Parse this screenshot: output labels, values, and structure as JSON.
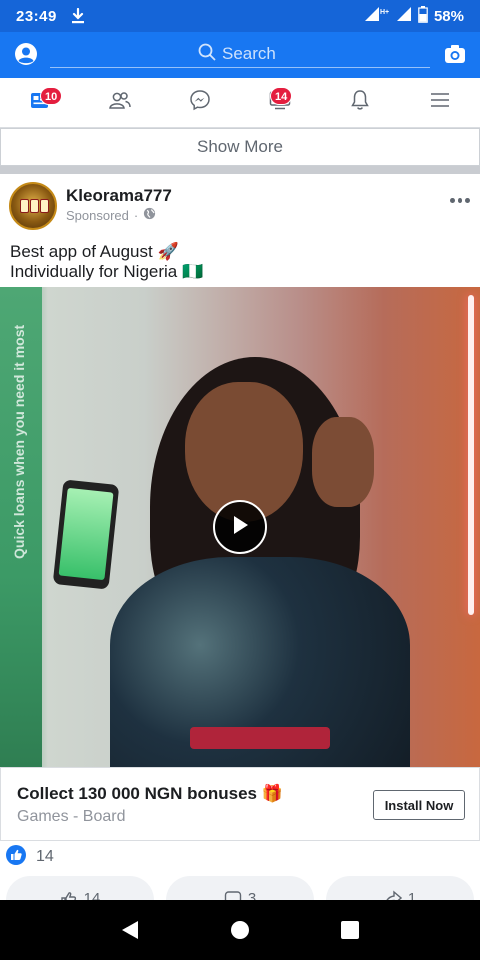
{
  "status_bar": {
    "time": "23:49",
    "battery": "58%",
    "icons": [
      "download-icon",
      "wifi-icon",
      "signal-icon",
      "battery-icon"
    ]
  },
  "header": {
    "search_placeholder": "Search",
    "icons": [
      "profile-icon",
      "search-icon",
      "camera-icon"
    ]
  },
  "nav_tabs": [
    {
      "name": "news-feed",
      "icon": "news-feed-icon",
      "badge": "10"
    },
    {
      "name": "friends",
      "icon": "friends-icon",
      "badge": ""
    },
    {
      "name": "messenger",
      "icon": "messenger-icon",
      "badge": ""
    },
    {
      "name": "watch",
      "icon": "watch-icon",
      "badge": "14"
    },
    {
      "name": "notifications",
      "icon": "bell-icon",
      "badge": ""
    },
    {
      "name": "menu",
      "icon": "menu-icon",
      "badge": ""
    }
  ],
  "feed": {
    "show_more_label": "Show More"
  },
  "post": {
    "author": "Kleorama777",
    "sponsored_label": "Sponsored",
    "meta_separator": "·",
    "text_line1": "Best app of August 🚀",
    "text_line2": "Individually for Nigeria 🇳🇬",
    "video_caption": "Quick loans when you need it most",
    "cta_title": "Collect 130 000 NGN bonuses 🎁",
    "cta_subtitle": "Games - Board",
    "cta_button": "Install Now",
    "reaction_count": "14",
    "actions": [
      {
        "label": "14",
        "icon": "like-icon"
      },
      {
        "label": "3",
        "icon": "comment-icon"
      },
      {
        "label": "1",
        "icon": "share-icon"
      }
    ]
  },
  "colors": {
    "brand_blue": "#1877f2",
    "status_blue": "#1565d8",
    "badge_red": "#e41e3f",
    "separator_gray": "#c9ccd1"
  }
}
